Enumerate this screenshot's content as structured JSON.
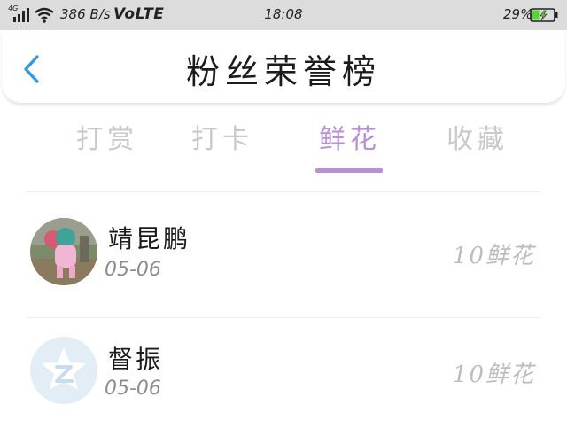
{
  "status_bar": {
    "network": "4G",
    "speed": "386 B/s",
    "volte": "VoLTE",
    "time": "18:08",
    "battery_percent": "29%"
  },
  "header": {
    "title": "粉丝荣誉榜",
    "back_icon": "chevron-left-icon"
  },
  "tabs": [
    {
      "label": "打赏",
      "active": false
    },
    {
      "label": "打卡",
      "active": false
    },
    {
      "label": "鲜花",
      "active": true
    },
    {
      "label": "收藏",
      "active": false
    }
  ],
  "list": [
    {
      "name": "靖昆鹏",
      "date": "05-06",
      "count": "10鲜花",
      "avatar_icon": "user-photo-avatar"
    },
    {
      "name": "督振",
      "date": "05-06",
      "count": "10鲜花",
      "avatar_icon": "default-avatar-icon"
    }
  ],
  "colors": {
    "accent": "#b98fd8",
    "back_icon": "#2f9be6",
    "status_bar_bg": "#dcdcdc",
    "battery_fill": "#5ccf3a"
  }
}
